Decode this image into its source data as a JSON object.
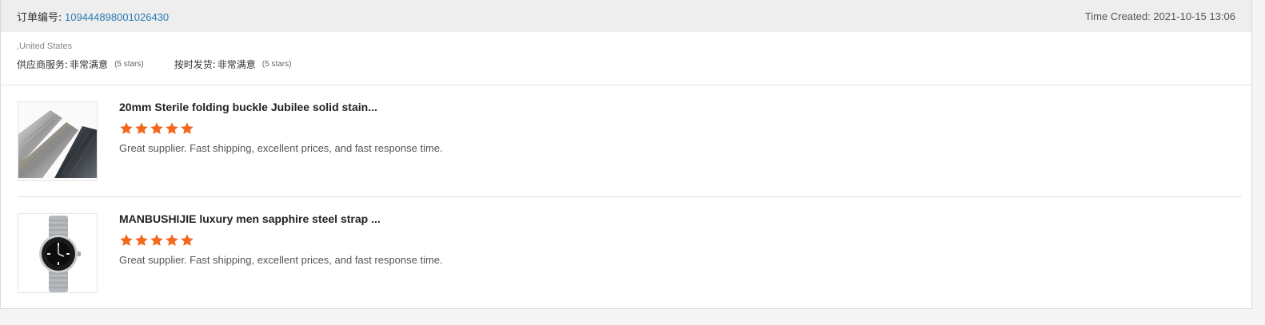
{
  "order": {
    "number_label": "订单编号:",
    "number": "109444898001026430",
    "time_created_label": "Time Created:",
    "time_created": "2021-10-15 13:06"
  },
  "store": {
    "country": ",United States",
    "ratings": [
      {
        "label": "供应商服务:",
        "value": "非常满意",
        "stars_text": "(5 stars)"
      },
      {
        "label": "按时发货:",
        "value": "非常满意",
        "stars_text": "(5 stars)"
      }
    ]
  },
  "products": [
    {
      "title": "20mm Sterile folding buckle Jubilee solid stain...",
      "rating": 5,
      "feedback": "Great supplier. Fast shipping, excellent prices, and fast response time."
    },
    {
      "title": "MANBUSHIJIE luxury men sapphire steel strap ...",
      "rating": 5,
      "feedback": "Great supplier. Fast shipping, excellent prices, and fast response time."
    }
  ],
  "colors": {
    "star": "#f2681c",
    "link": "#2a7ab0",
    "header_bg": "#eeeeee"
  }
}
